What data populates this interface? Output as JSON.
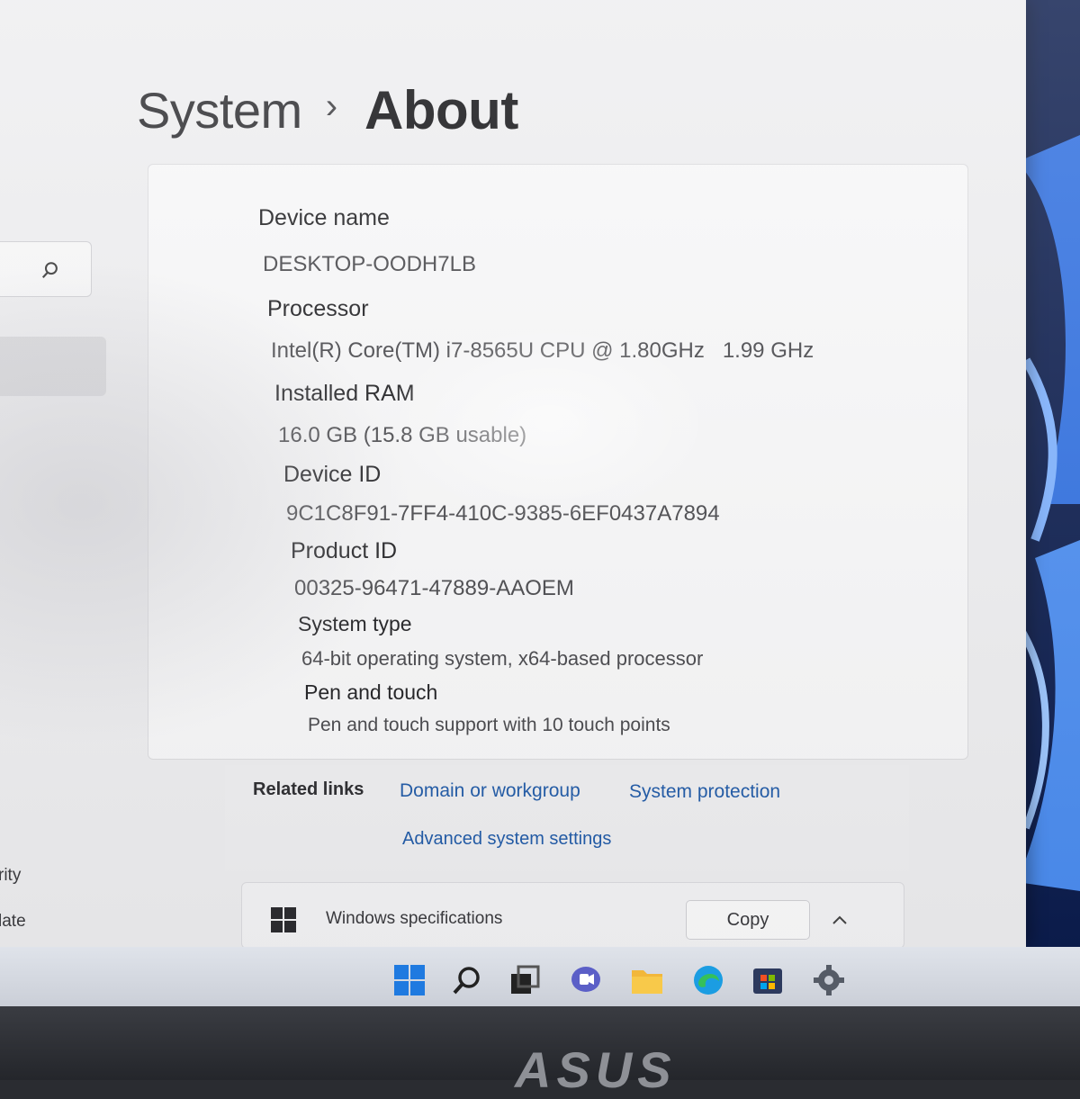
{
  "breadcrumb": {
    "parent": "System",
    "separator": "›",
    "current": "About"
  },
  "sidebar": {
    "partial_items": [
      "rity",
      "late"
    ]
  },
  "device_specs": [
    {
      "label": "Device name",
      "value": "DESKTOP-OODH7LB"
    },
    {
      "label": "Processor",
      "value": "Intel(R) Core(TM) i7-8565U CPU @ 1.80GHz   1.99 GHz"
    },
    {
      "label": "Installed RAM",
      "value": "16.0 GB (15.8 GB usable)"
    },
    {
      "label": "Device ID",
      "value": "9C1C8F91-7FF4-410C-9385-6EF0437A7894"
    },
    {
      "label": "Product ID",
      "value": "00325-96471-47889-AAOEM"
    },
    {
      "label": "System type",
      "value": "64-bit operating system, x64-based processor"
    },
    {
      "label": "Pen and touch",
      "value": "Pen and touch support with 10 touch points"
    }
  ],
  "related_links": {
    "label": "Related links",
    "links": [
      "Domain or workgroup",
      "System protection",
      "Advanced system settings"
    ]
  },
  "windows_specifications": {
    "label": "Windows specifications",
    "copy_label": "Copy"
  },
  "taskbar": {
    "icons": [
      "start-icon",
      "search-icon",
      "task-view-icon",
      "teams-chat-icon",
      "file-explorer-icon",
      "edge-icon",
      "store-icon",
      "settings-icon"
    ]
  },
  "bezel": {
    "brand": "ASUS"
  },
  "colors": {
    "accent_link": "#1f5aa8",
    "window_bg": "#eeeef0",
    "card_bg": "#f8f8f9",
    "wallpaper": "#0d1f52"
  }
}
